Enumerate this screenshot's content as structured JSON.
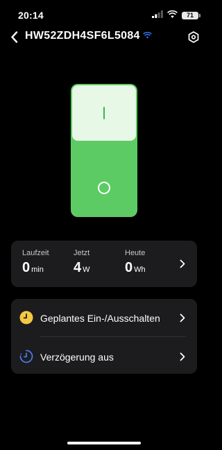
{
  "status_bar": {
    "time": "20:14",
    "battery": "71"
  },
  "header": {
    "title": "HW52ZDH4SF6L5084"
  },
  "switch": {
    "state": "on"
  },
  "stats": [
    {
      "label": "Laufzeit",
      "value": "0",
      "unit": "min"
    },
    {
      "label": "Jetzt",
      "value": "4",
      "unit": "W"
    },
    {
      "label": "Heute",
      "value": "0",
      "unit": "Wh"
    }
  ],
  "schedule": {
    "items": [
      {
        "label": "Geplantes Ein-/Ausschalten",
        "icon": "clock-icon"
      },
      {
        "label": "Verzögerung aus",
        "icon": "timer-icon"
      }
    ]
  },
  "colors": {
    "accent": "#5dcb64",
    "wifi": "#3478f6",
    "clock": "#f5c842",
    "timer": "#4a7cf0"
  }
}
